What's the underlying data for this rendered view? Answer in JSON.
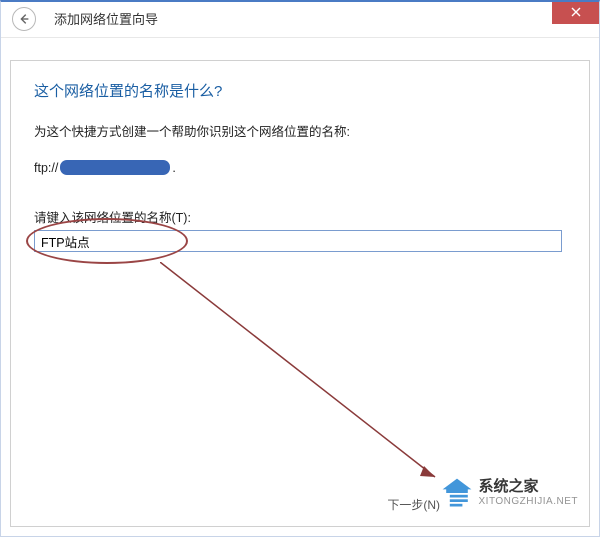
{
  "titlebar": {
    "title": "添加网络位置向导"
  },
  "content": {
    "heading": "这个网络位置的名称是什么?",
    "instruction": "为这个快捷方式创建一个帮助你识别这个网络位置的名称:",
    "url_prefix": "ftp://",
    "url_suffix": ".",
    "label": "请键入该网络位置的名称(T):",
    "input_value": "FTP站点"
  },
  "footer": {
    "next_label": "下一步(N)"
  },
  "watermark": {
    "name": "系统之家",
    "domain": "XITONGZHIJIA.NET"
  }
}
